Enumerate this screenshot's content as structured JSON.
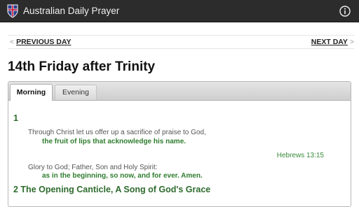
{
  "app": {
    "title": "Australian Daily Prayer",
    "logo_icon": "shield-cross-icon",
    "info_icon": "info-icon"
  },
  "nav": {
    "prev_arrow": "<",
    "prev_label": "PREVIOUS DAY",
    "next_label": "NEXT DAY",
    "next_arrow": ">"
  },
  "page": {
    "title": "14th Friday after Trinity"
  },
  "tabs": [
    {
      "label": "Morning",
      "selected": true
    },
    {
      "label": "Evening",
      "selected": false
    }
  ],
  "content": {
    "section1_number": "1",
    "verse1_lead": "Through Christ let us offer up a sacrifice of praise to God,",
    "verse1_response": "the fruit of lips that acknowledge his name.",
    "verse1_reference": "Hebrews 13:15",
    "verse2_lead": "Glory to God; Father, Son and Holy Spirit:",
    "verse2_response": "as in the beginning, so now, and for ever. Amen.",
    "section2_title": "2 The Opening Canticle, A Song of God's Grace"
  },
  "colors": {
    "appbar": "#2c2c2c",
    "accent_green": "#2e6b2e",
    "response_green": "#2f7d2f"
  }
}
